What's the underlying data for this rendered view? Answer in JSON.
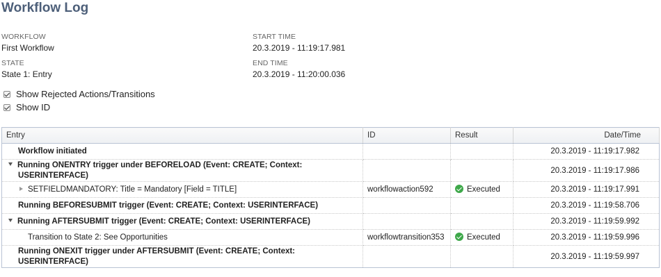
{
  "page": {
    "title": "Workflow Log"
  },
  "info": {
    "workflow_label": "WORKFLOW",
    "workflow_value": "First Workflow",
    "state_label": "STATE",
    "state_value": "State 1: Entry",
    "start_label": "START TIME",
    "start_value": "20.3.2019 - 11:19:17.981",
    "end_label": "END TIME",
    "end_value": "20.3.2019 - 11:20:00.036"
  },
  "options": {
    "show_rejected": {
      "label": "Show Rejected Actions/Transitions",
      "checked": true
    },
    "show_id": {
      "label": "Show ID",
      "checked": true
    }
  },
  "table": {
    "headers": {
      "entry": "Entry",
      "id": "ID",
      "result": "Result",
      "datetime": "Date/Time"
    },
    "rows": [
      {
        "entry_line1": "Workflow initiated",
        "entry_line2": "",
        "id": "",
        "result": "",
        "datetime": "20.3.2019 - 11:19:17.982"
      },
      {
        "entry_line1": "Running ONENTRY trigger under BEFORELOAD (Event: CREATE; Context:",
        "entry_line2": "USERINTERFACE)",
        "id": "",
        "result": "",
        "datetime": "20.3.2019 - 11:19:17.986"
      },
      {
        "entry_line1": "SETFIELDMANDATORY: Title = Mandatory [Field = TITLE]",
        "entry_line2": "",
        "id": "workflowaction592",
        "result": "Executed",
        "datetime": "20.3.2019 - 11:19:17.991"
      },
      {
        "entry_line1": "Running BEFORESUBMIT trigger (Event: CREATE; Context: USERINTERFACE)",
        "entry_line2": "",
        "id": "",
        "result": "",
        "datetime": "20.3.2019 - 11:19:58.706"
      },
      {
        "entry_line1": "Running AFTERSUBMIT trigger (Event: CREATE; Context: USERINTERFACE)",
        "entry_line2": "",
        "id": "",
        "result": "",
        "datetime": "20.3.2019 - 11:19:59.992"
      },
      {
        "entry_line1": "Transition to State 2: See Opportunities",
        "entry_line2": "",
        "id": "workflowtransition353",
        "result": "Executed",
        "datetime": "20.3.2019 - 11:19:59.996"
      },
      {
        "entry_line1": "Running ONEXIT trigger under AFTERSUBMIT (Event: CREATE; Context:",
        "entry_line2": "USERINTERFACE)",
        "id": "",
        "result": "",
        "datetime": "20.3.2019 - 11:19:59.997"
      }
    ]
  },
  "icons": {
    "expanded": "triangle-down-icon",
    "collapsed": "triangle-right-icon",
    "executed": "check-circle-icon"
  },
  "colors": {
    "title": "#4d5f79",
    "executed_icon": "#3ea84a",
    "grid_border": "#b9c3d4"
  }
}
